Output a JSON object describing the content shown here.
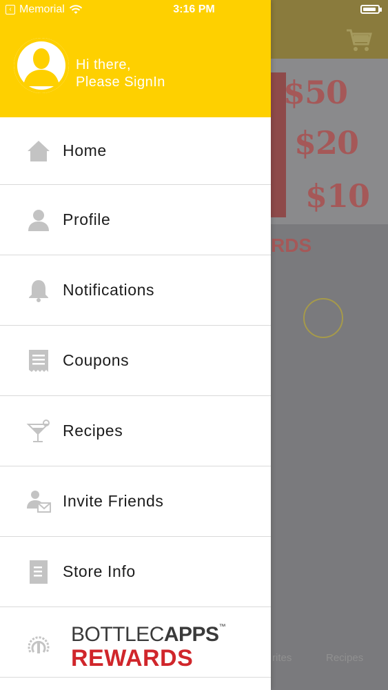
{
  "status_bar": {
    "carrier": "Memorial",
    "time": "3:16 PM"
  },
  "background_app": {
    "amounts": [
      "$50",
      "$20",
      "$10"
    ],
    "rewards_fragment": "RDS",
    "tab_fragments": [
      "rites",
      "Recipes"
    ]
  },
  "drawer": {
    "greeting_line1": "Hi there,",
    "greeting_line2": "Please SignIn",
    "menu": [
      {
        "label": "Home",
        "icon": "home-icon"
      },
      {
        "label": "Profile",
        "icon": "person-icon"
      },
      {
        "label": "Notifications",
        "icon": "bell-icon"
      },
      {
        "label": "Coupons",
        "icon": "coupon-icon"
      },
      {
        "label": "Recipes",
        "icon": "cocktail-icon"
      },
      {
        "label": "Invite Friends",
        "icon": "invite-icon"
      },
      {
        "label": "Store Info",
        "icon": "document-icon"
      }
    ],
    "brand": {
      "line1_a": "BOTTLEC",
      "line1_b": "APPS",
      "line2": "REWARDS"
    }
  },
  "colors": {
    "header_yellow": "#fed000",
    "icon_gray": "#c3c3c3",
    "brand_red": "#d0262b"
  }
}
